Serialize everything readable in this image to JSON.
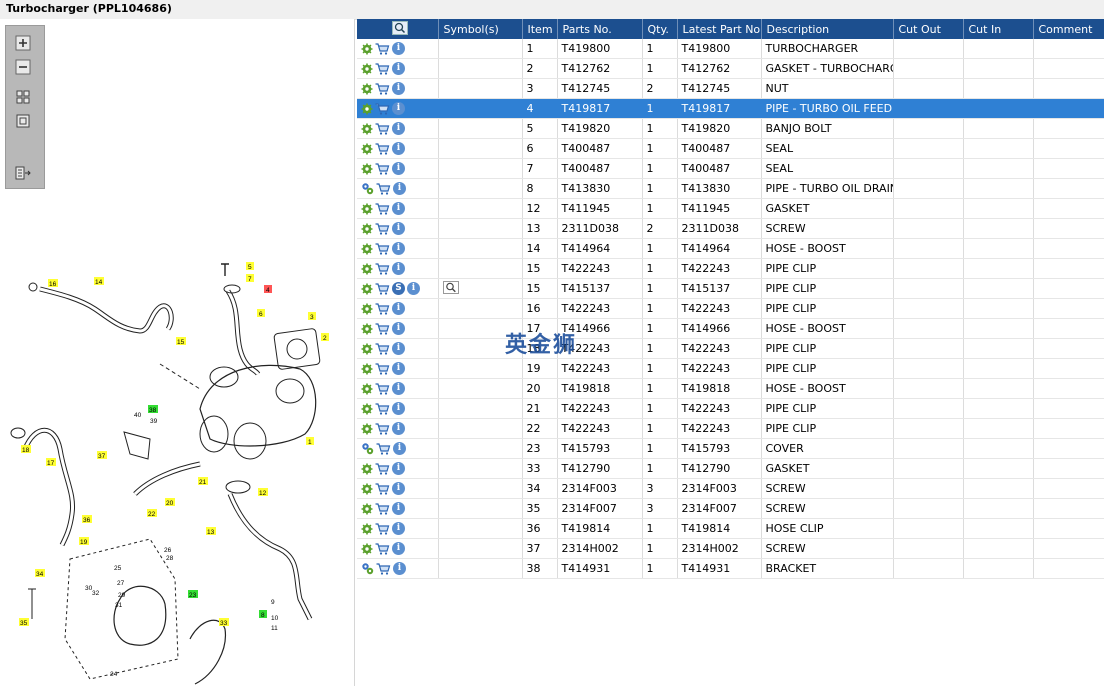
{
  "window": {
    "title": "Turbocharger (PPL104686)"
  },
  "watermark": "英金狮",
  "colors": {
    "header_bg": "#1c4f8f",
    "selected_row": "#2f80d4",
    "callout_yellow": "#ffff33",
    "callout_green": "#33dd33",
    "callout_red": "#ff5555"
  },
  "toolbox": {
    "buttons": [
      "zoom-in-icon",
      "zoom-out-icon",
      "fit-grid-icon",
      "fit-page-icon",
      "export-list-icon"
    ]
  },
  "table": {
    "columns": [
      "",
      "Symbol(s)",
      "Item",
      "Parts No.",
      "Qty.",
      "Latest Part No.",
      "Description",
      "Cut Out",
      "Cut In",
      "Comment"
    ],
    "rows": [
      {
        "item": "1",
        "part": "T419800",
        "qty": "1",
        "latest": "T419800",
        "desc": "TURBOCHARGER",
        "icon": "gear",
        "sym": ""
      },
      {
        "item": "2",
        "part": "T412762",
        "qty": "1",
        "latest": "T412762",
        "desc": "GASKET - TURBOCHARGER",
        "icon": "gear",
        "sym": ""
      },
      {
        "item": "3",
        "part": "T412745",
        "qty": "2",
        "latest": "T412745",
        "desc": "NUT",
        "icon": "gear",
        "sym": ""
      },
      {
        "item": "4",
        "part": "T419817",
        "qty": "1",
        "latest": "T419817",
        "desc": "PIPE - TURBO OIL FEED",
        "icon": "gear",
        "sym": "",
        "selected": true
      },
      {
        "item": "5",
        "part": "T419820",
        "qty": "1",
        "latest": "T419820",
        "desc": "BANJO BOLT",
        "icon": "gear",
        "sym": ""
      },
      {
        "item": "6",
        "part": "T400487",
        "qty": "1",
        "latest": "T400487",
        "desc": "SEAL",
        "icon": "gear",
        "sym": ""
      },
      {
        "item": "7",
        "part": "T400487",
        "qty": "1",
        "latest": "T400487",
        "desc": "SEAL",
        "icon": "gear",
        "sym": ""
      },
      {
        "item": "8",
        "part": "T413830",
        "qty": "1",
        "latest": "T413830",
        "desc": "PIPE - TURBO OIL DRAIN",
        "icon": "gears",
        "sym": ""
      },
      {
        "item": "12",
        "part": "T411945",
        "qty": "1",
        "latest": "T411945",
        "desc": "GASKET",
        "icon": "gear",
        "sym": ""
      },
      {
        "item": "13",
        "part": "2311D038",
        "qty": "2",
        "latest": "2311D038",
        "desc": "SCREW",
        "icon": "gear",
        "sym": ""
      },
      {
        "item": "14",
        "part": "T414964",
        "qty": "1",
        "latest": "T414964",
        "desc": "HOSE - BOOST",
        "icon": "gear",
        "sym": ""
      },
      {
        "item": "15",
        "part": "T422243",
        "qty": "1",
        "latest": "T422243",
        "desc": "PIPE CLIP",
        "icon": "gear",
        "sym": ""
      },
      {
        "item": "15",
        "part": "T415137",
        "qty": "1",
        "latest": "T415137",
        "desc": "PIPE CLIP",
        "icon": "gear",
        "sym": "S"
      },
      {
        "item": "16",
        "part": "T422243",
        "qty": "1",
        "latest": "T422243",
        "desc": "PIPE CLIP",
        "icon": "gear",
        "sym": ""
      },
      {
        "item": "17",
        "part": "T414966",
        "qty": "1",
        "latest": "T414966",
        "desc": "HOSE - BOOST",
        "icon": "gear",
        "sym": ""
      },
      {
        "item": "18",
        "part": "T422243",
        "qty": "1",
        "latest": "T422243",
        "desc": "PIPE CLIP",
        "icon": "gear",
        "sym": ""
      },
      {
        "item": "19",
        "part": "T422243",
        "qty": "1",
        "latest": "T422243",
        "desc": "PIPE CLIP",
        "icon": "gear",
        "sym": ""
      },
      {
        "item": "20",
        "part": "T419818",
        "qty": "1",
        "latest": "T419818",
        "desc": "HOSE - BOOST",
        "icon": "gear",
        "sym": ""
      },
      {
        "item": "21",
        "part": "T422243",
        "qty": "1",
        "latest": "T422243",
        "desc": "PIPE CLIP",
        "icon": "gear",
        "sym": ""
      },
      {
        "item": "22",
        "part": "T422243",
        "qty": "1",
        "latest": "T422243",
        "desc": "PIPE CLIP",
        "icon": "gear",
        "sym": ""
      },
      {
        "item": "23",
        "part": "T415793",
        "qty": "1",
        "latest": "T415793",
        "desc": "COVER",
        "icon": "gears",
        "sym": ""
      },
      {
        "item": "33",
        "part": "T412790",
        "qty": "1",
        "latest": "T412790",
        "desc": "GASKET",
        "icon": "gear",
        "sym": ""
      },
      {
        "item": "34",
        "part": "2314F003",
        "qty": "3",
        "latest": "2314F003",
        "desc": "SCREW",
        "icon": "gear",
        "sym": ""
      },
      {
        "item": "35",
        "part": "2314F007",
        "qty": "3",
        "latest": "2314F007",
        "desc": "SCREW",
        "icon": "gear",
        "sym": ""
      },
      {
        "item": "36",
        "part": "T419814",
        "qty": "1",
        "latest": "T419814",
        "desc": "HOSE CLIP",
        "icon": "gear",
        "sym": ""
      },
      {
        "item": "37",
        "part": "2314H002",
        "qty": "1",
        "latest": "2314H002",
        "desc": "SCREW",
        "icon": "gear",
        "sym": ""
      },
      {
        "item": "38",
        "part": "T414931",
        "qty": "1",
        "latest": "T414931",
        "desc": "BRACKET",
        "icon": "gears",
        "sym": ""
      }
    ]
  },
  "diagram": {
    "callouts": [
      {
        "text": "16",
        "color": "yellow"
      },
      {
        "text": "14",
        "color": "yellow"
      },
      {
        "text": "5",
        "color": "yellow"
      },
      {
        "text": "7",
        "color": "yellow"
      },
      {
        "text": "4",
        "color": "red"
      },
      {
        "text": "6",
        "color": "yellow"
      },
      {
        "text": "3",
        "color": "yellow"
      },
      {
        "text": "2",
        "color": "yellow"
      },
      {
        "text": "15",
        "color": "yellow"
      },
      {
        "text": "38",
        "color": "green"
      },
      {
        "text": "40",
        "color": "none"
      },
      {
        "text": "39",
        "color": "none"
      },
      {
        "text": "37",
        "color": "yellow"
      },
      {
        "text": "18",
        "color": "yellow"
      },
      {
        "text": "17",
        "color": "yellow"
      },
      {
        "text": "1",
        "color": "yellow"
      },
      {
        "text": "21",
        "color": "yellow"
      },
      {
        "text": "12",
        "color": "yellow"
      },
      {
        "text": "20",
        "color": "yellow"
      },
      {
        "text": "22",
        "color": "yellow"
      },
      {
        "text": "36",
        "color": "yellow"
      },
      {
        "text": "13",
        "color": "yellow"
      },
      {
        "text": "19",
        "color": "yellow"
      },
      {
        "text": "26",
        "color": "none"
      },
      {
        "text": "28",
        "color": "none"
      },
      {
        "text": "25",
        "color": "none"
      },
      {
        "text": "34",
        "color": "yellow"
      },
      {
        "text": "27",
        "color": "none"
      },
      {
        "text": "30",
        "color": "none"
      },
      {
        "text": "32",
        "color": "none"
      },
      {
        "text": "29",
        "color": "none"
      },
      {
        "text": "31",
        "color": "none"
      },
      {
        "text": "23",
        "color": "green"
      },
      {
        "text": "8",
        "color": "green"
      },
      {
        "text": "9",
        "color": "none"
      },
      {
        "text": "10",
        "color": "none"
      },
      {
        "text": "11",
        "color": "none"
      },
      {
        "text": "35",
        "color": "yellow"
      },
      {
        "text": "33",
        "color": "yellow"
      },
      {
        "text": "24",
        "color": "none"
      }
    ]
  }
}
